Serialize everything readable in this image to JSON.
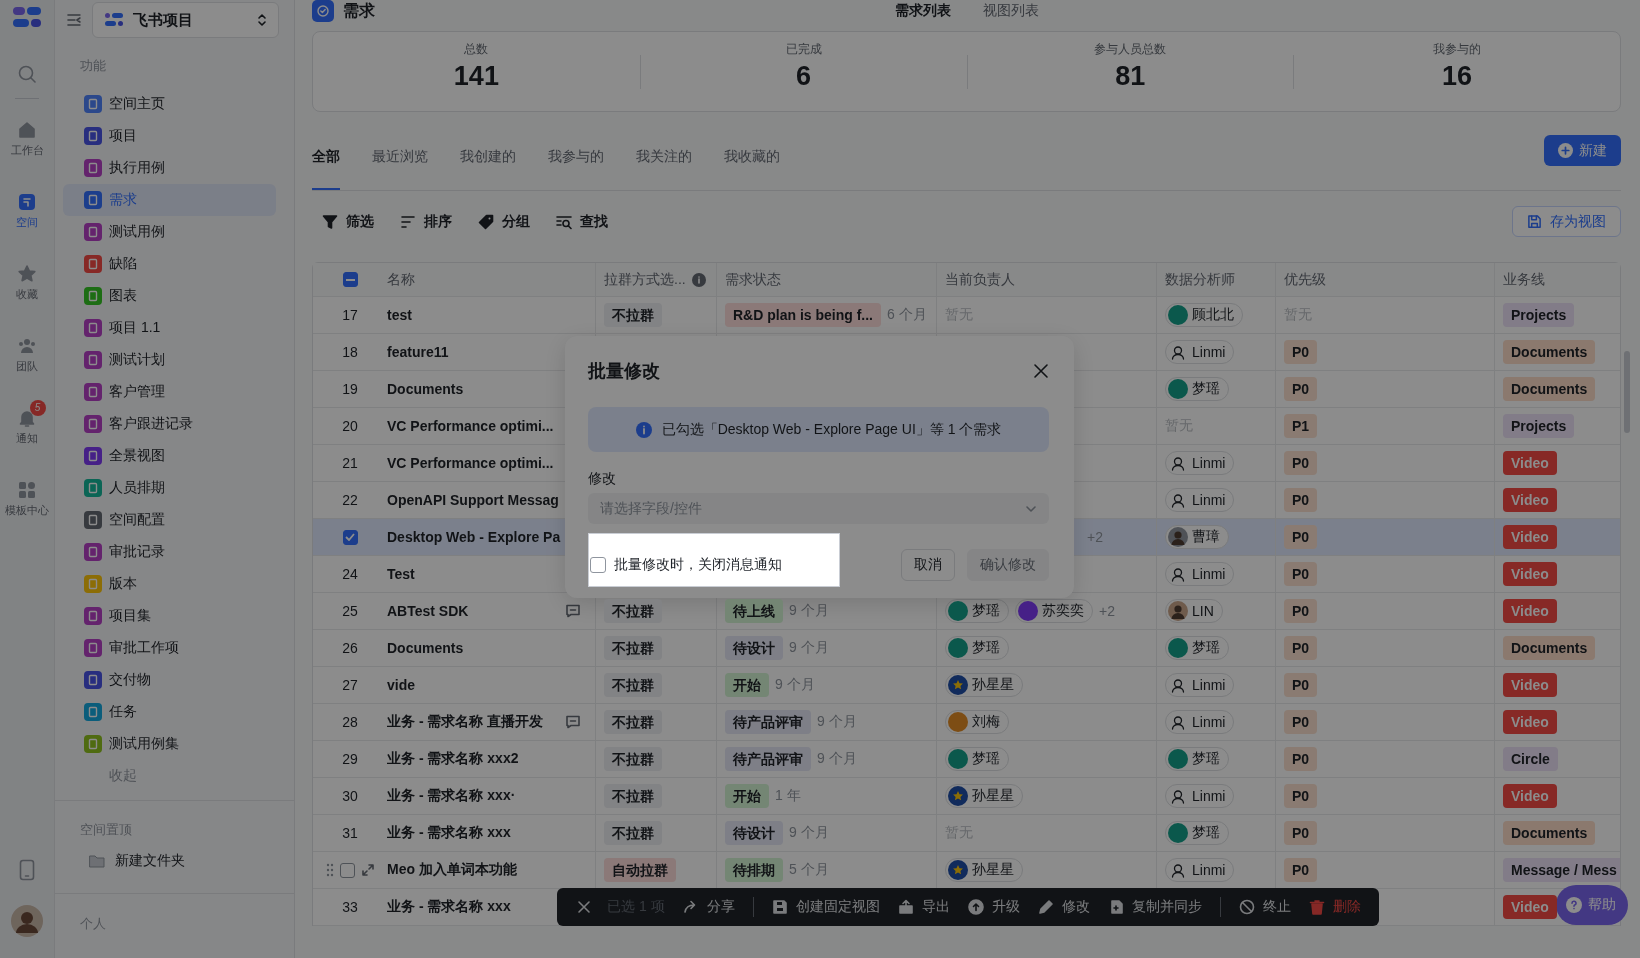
{
  "rail": {
    "items": [
      {
        "label": "工作台",
        "selected": false
      },
      {
        "label": "空间",
        "selected": true
      },
      {
        "label": "收藏",
        "selected": false
      },
      {
        "label": "团队",
        "selected": false
      },
      {
        "label": "通知",
        "selected": false,
        "badge": "5"
      },
      {
        "label": "模板中心",
        "selected": false
      }
    ]
  },
  "sidebar": {
    "project": "飞书项目",
    "section": "功能",
    "items": [
      {
        "label": "空间主页",
        "color": "#2b488b",
        "selected": false
      },
      {
        "label": "项目",
        "color": "#282e7f",
        "selected": false
      },
      {
        "label": "执行用例",
        "color": "#64236d",
        "selected": false
      },
      {
        "label": "需求",
        "color": "#1c3e8c",
        "selected": true
      },
      {
        "label": "测试用例",
        "color": "#64236d",
        "selected": false
      },
      {
        "label": "缺陷",
        "color": "#872926",
        "selected": false
      },
      {
        "label": "图表",
        "color": "#1d6d14",
        "selected": false
      },
      {
        "label": "项目 1.1",
        "color": "#64236d",
        "selected": false
      },
      {
        "label": "测试计划",
        "color": "#64236d",
        "selected": false
      },
      {
        "label": "客户管理",
        "color": "#64236d",
        "selected": false
      },
      {
        "label": "客户跟进记录",
        "color": "#64236d",
        "selected": false
      },
      {
        "label": "全景视图",
        "color": "#462087",
        "selected": false
      },
      {
        "label": "人员排期",
        "color": "#0b6555",
        "selected": false
      },
      {
        "label": "空间配置",
        "color": "#373a3f",
        "selected": false
      },
      {
        "label": "审批记录",
        "color": "#64236d",
        "selected": false
      },
      {
        "label": "版本",
        "color": "#8c6d06",
        "selected": false
      },
      {
        "label": "项目集",
        "color": "#64236d",
        "selected": false
      },
      {
        "label": "审批工作项",
        "color": "#64236d",
        "selected": false
      },
      {
        "label": "交付物",
        "color": "#282e7f",
        "selected": false
      },
      {
        "label": "任务",
        "color": "#0b5d7b",
        "selected": false
      },
      {
        "label": "测试用例集",
        "color": "#4f6b11",
        "selected": false
      }
    ],
    "collapse": "收起",
    "pinned_title": "空间置顶",
    "pinned_items": [
      "新建文件夹"
    ],
    "personal_title": "个人"
  },
  "main": {
    "title": "需求",
    "views": [
      {
        "label": "需求列表",
        "selected": true
      },
      {
        "label": "视图列表",
        "selected": false
      }
    ],
    "stats": [
      {
        "label": "总数",
        "value": "141"
      },
      {
        "label": "已完成",
        "value": "6"
      },
      {
        "label": "参与人员总数",
        "value": "81"
      },
      {
        "label": "我参与的",
        "value": "16"
      }
    ],
    "tabs": [
      {
        "label": "全部",
        "selected": true
      },
      {
        "label": "最近浏览",
        "selected": false
      },
      {
        "label": "我创建的",
        "selected": false
      },
      {
        "label": "我参与的",
        "selected": false
      },
      {
        "label": "我关注的",
        "selected": false
      },
      {
        "label": "我收藏的",
        "selected": false
      }
    ],
    "new_button": "新建",
    "toolbar": [
      "筛选",
      "排序",
      "分组",
      "查找"
    ],
    "save_view": "存为视图"
  },
  "table": {
    "header_checkbox": {
      "kind": "partial"
    },
    "columns": [
      {
        "label": "名称",
        "info": false
      },
      {
        "label": "拉群方式选...",
        "info": true
      },
      {
        "label": "需求状态",
        "info": false
      },
      {
        "label": "当前负责人",
        "info": false
      },
      {
        "label": "数据分析师",
        "info": false
      },
      {
        "label": "优先级",
        "info": false
      },
      {
        "label": "业务线",
        "info": false
      }
    ],
    "rows": [
      {
        "kind": "number",
        "number": "17",
        "selected": false,
        "name": "test",
        "comment": false,
        "group": {
          "text": "不拉群",
          "color": "#828385"
        },
        "status": {
          "text": "R&D plan is being f...",
          "color": "#8b7978"
        },
        "age": "6 个月",
        "owners": [
          {
            "kind": "empty",
            "text": "暂无"
          }
        ],
        "analyst": [
          {
            "kind": "initials",
            "name": "顾北北",
            "color": "#0b584c"
          }
        ],
        "priority": {
          "kind": "empty",
          "text": "暂无"
        },
        "biz": {
          "text": "Projects",
          "color": "#827c88"
        }
      },
      {
        "kind": "number",
        "number": "18",
        "selected": false,
        "name": "feature11",
        "comment": false,
        "analyst": [
          {
            "kind": "outline",
            "name": "Linmi",
            "color": "#8c8c8c"
          }
        ],
        "priority": {
          "kind": "tag",
          "text": "P0"
        },
        "biz": {
          "text": "Documents",
          "color": "#8b796e"
        }
      },
      {
        "kind": "number",
        "number": "19",
        "selected": false,
        "name": "Documents",
        "comment": false,
        "analyst": [
          {
            "kind": "initials",
            "name": "梦瑶",
            "color": "#0b584c"
          }
        ],
        "priority": {
          "kind": "tag",
          "text": "P0"
        },
        "biz": {
          "text": "Documents",
          "color": "#8b796e"
        }
      },
      {
        "kind": "number",
        "number": "20",
        "selected": false,
        "name": "VC Performance optimi...",
        "comment": false,
        "analyst": [
          {
            "kind": "empty",
            "text": "暂无"
          }
        ],
        "priority": {
          "kind": "tag",
          "text": "P1"
        },
        "biz": {
          "text": "Projects",
          "color": "#827c88"
        }
      },
      {
        "kind": "number",
        "number": "21",
        "selected": false,
        "name": "VC Performance optimi...",
        "comment": false,
        "analyst": [
          {
            "kind": "outline",
            "name": "Linmi",
            "color": "#8c8c8c"
          }
        ],
        "priority": {
          "kind": "tag",
          "text": "P0"
        },
        "biz": {
          "text": "Video",
          "color": "#872926"
        }
      },
      {
        "kind": "number",
        "number": "22",
        "selected": false,
        "name": "OpenAPI Support Messag",
        "comment": false,
        "analyst": [
          {
            "kind": "outline",
            "name": "Linmi",
            "color": "#8c8c8c"
          }
        ],
        "priority": {
          "kind": "tag",
          "text": "P0"
        },
        "biz": {
          "text": "Video",
          "color": "#872926"
        }
      },
      {
        "kind": "number",
        "selected": true,
        "name": "Desktop Web - Explore Pa",
        "comment": false,
        "owners": [
          {
            "kind": "more",
            "text": "+2"
          }
        ],
        "analyst": [
          {
            "kind": "photo",
            "name": "曹璋",
            "color": "#4f5257"
          }
        ],
        "priority": {
          "kind": "tag",
          "text": "P0"
        },
        "biz": {
          "text": "Video",
          "color": "#872926"
        }
      },
      {
        "kind": "number",
        "number": "24",
        "selected": false,
        "name": "Test",
        "comment": false,
        "analyst": [
          {
            "kind": "outline",
            "name": "Linmi",
            "color": "#8c8c8c"
          }
        ],
        "priority": {
          "kind": "tag",
          "text": "P0"
        },
        "biz": {
          "text": "Video",
          "color": "#872926"
        }
      },
      {
        "kind": "number",
        "number": "25",
        "selected": false,
        "name": "ABTest SDK",
        "comment": true,
        "group": {
          "text": "不拉群",
          "color": "#828385"
        },
        "status": {
          "text": "待上线",
          "color": "#748674"
        },
        "age": "9 个月",
        "owners": [
          {
            "kind": "initials",
            "name": "梦瑶",
            "color": "#0b584c"
          },
          {
            "kind": "initials",
            "name": "苏奕奕",
            "color": "#462087"
          },
          {
            "kind": "more",
            "text": "+2"
          }
        ],
        "analyst": [
          {
            "kind": "photo",
            "name": "LIN",
            "color": "#6f5b4c"
          }
        ],
        "priority": {
          "kind": "tag",
          "text": "P0"
        },
        "biz": {
          "text": "Video",
          "color": "#872926"
        }
      },
      {
        "kind": "number",
        "number": "26",
        "selected": false,
        "name": "Documents",
        "comment": false,
        "group": {
          "text": "不拉群",
          "color": "#828385"
        },
        "status": {
          "text": "待设计",
          "color": "#7e7f87"
        },
        "age": "9 个月",
        "owners": [
          {
            "kind": "initials",
            "name": "梦瑶",
            "color": "#0b584c"
          }
        ],
        "analyst": [
          {
            "kind": "initials",
            "name": "梦瑶",
            "color": "#0b584c"
          }
        ],
        "priority": {
          "kind": "tag",
          "text": "P0"
        },
        "biz": {
          "text": "Documents",
          "color": "#8b796e"
        }
      },
      {
        "kind": "number",
        "number": "27",
        "selected": false,
        "name": "vide",
        "comment": false,
        "group": {
          "text": "不拉群",
          "color": "#828385"
        },
        "status": {
          "text": "开始",
          "color": "#748674"
        },
        "age": "9 个月",
        "owners": [
          {
            "kind": "star",
            "name": "孙星星",
            "color": "#112b5c"
          }
        ],
        "analyst": [
          {
            "kind": "outline",
            "name": "Linmi",
            "color": "#8c8c8c"
          }
        ],
        "priority": {
          "kind": "tag",
          "text": "P0"
        },
        "biz": {
          "text": "Video",
          "color": "#872926"
        }
      },
      {
        "kind": "number",
        "number": "28",
        "selected": false,
        "name": "业务 - 需求名称 直播开发",
        "comment": true,
        "group": {
          "text": "不拉群",
          "color": "#828385"
        },
        "status": {
          "text": "待产品评审",
          "color": "#7e7f87"
        },
        "age": "9 个月",
        "owners": [
          {
            "kind": "initials",
            "name": "刘梅",
            "color": "#7d4d14"
          }
        ],
        "analyst": [
          {
            "kind": "outline",
            "name": "Linmi",
            "color": "#8c8c8c"
          }
        ],
        "priority": {
          "kind": "tag",
          "text": "P0"
        },
        "biz": {
          "text": "Video",
          "color": "#872926"
        }
      },
      {
        "kind": "number",
        "number": "29",
        "selected": false,
        "name": "业务 - 需求名称 xxx2",
        "comment": false,
        "group": {
          "text": "不拉群",
          "color": "#828385"
        },
        "status": {
          "text": "待产品评审",
          "color": "#7e7f87"
        },
        "age": "9 个月",
        "owners": [
          {
            "kind": "initials",
            "name": "梦瑶",
            "color": "#0b584c"
          }
        ],
        "analyst": [
          {
            "kind": "initials",
            "name": "梦瑶",
            "color": "#0b584c"
          }
        ],
        "priority": {
          "kind": "tag",
          "text": "P0"
        },
        "biz": {
          "text": "Circle",
          "color": "#827c88"
        }
      },
      {
        "kind": "number",
        "number": "30",
        "selected": false,
        "name": "业务 - 需求名称 xxx·",
        "comment": false,
        "group": {
          "text": "不拉群",
          "color": "#828385"
        },
        "status": {
          "text": "开始",
          "color": "#748674"
        },
        "age": "1 年",
        "owners": [
          {
            "kind": "star",
            "name": "孙星星",
            "color": "#112b5c"
          }
        ],
        "analyst": [
          {
            "kind": "outline",
            "name": "Linmi",
            "color": "#8c8c8c"
          }
        ],
        "priority": {
          "kind": "tag",
          "text": "P0"
        },
        "biz": {
          "text": "Video",
          "color": "#872926"
        }
      },
      {
        "kind": "number",
        "number": "31",
        "selected": false,
        "name": "业务 - 需求名称 xxx",
        "comment": false,
        "group": {
          "text": "不拉群",
          "color": "#828385"
        },
        "status": {
          "text": "待设计",
          "color": "#7e7f87"
        },
        "age": "9 个月",
        "owners": [
          {
            "kind": "empty",
            "text": "暂无"
          }
        ],
        "analyst": [
          {
            "kind": "initials",
            "name": "梦瑶",
            "color": "#0b584c"
          }
        ],
        "priority": {
          "kind": "tag",
          "text": "P0"
        },
        "biz": {
          "text": "Documents",
          "color": "#8b796e"
        }
      },
      {
        "kind": "handle",
        "selected": false,
        "name": "Meo 加入单词本功能",
        "comment": false,
        "group": {
          "text": "自动拉群",
          "color": "#8b7978"
        },
        "status": {
          "text": "待排期",
          "color": "#748674"
        },
        "age": "5 个月",
        "owners": [
          {
            "kind": "star",
            "name": "孙星星",
            "color": "#112b5c"
          }
        ],
        "analyst": [
          {
            "kind": "outline",
            "name": "Linmi",
            "color": "#8c8c8c"
          }
        ],
        "priority": {
          "kind": "tag",
          "text": "P0"
        },
        "biz": {
          "text": "Message / Mess",
          "color": "#827c88"
        }
      },
      {
        "kind": "number",
        "number": "33",
        "selected": false,
        "name": "业务 - 需求名称 xxx",
        "comment": false,
        "biz": {
          "text": "Video",
          "color": "#872926"
        }
      }
    ]
  },
  "modal": {
    "title": "批量修改",
    "notice": "已勾选「Desktop Web - Explore Page UI」等 1 个需求",
    "field_label": "修改",
    "select_placeholder": "请选择字段/控件",
    "mute": {
      "label": "批量修改时，关闭消息通知",
      "checked": false,
      "highlighted": true
    },
    "cancel": "取消",
    "confirm": {
      "label": "确认修改",
      "disabled": true
    }
  },
  "action_bar": {
    "count": "已选 1 项",
    "items": [
      {
        "label": "分享",
        "kind": "normal"
      },
      {
        "kind": "divider"
      },
      {
        "label": "创建固定视图",
        "kind": "normal"
      },
      {
        "label": "导出",
        "kind": "normal"
      },
      {
        "label": "升级",
        "kind": "normal"
      },
      {
        "label": "修改",
        "kind": "normal"
      },
      {
        "label": "复制并同步",
        "kind": "normal"
      },
      {
        "kind": "divider"
      },
      {
        "label": "终止",
        "kind": "normal"
      },
      {
        "label": "删除",
        "kind": "danger"
      }
    ]
  },
  "help": {
    "label": "帮助"
  }
}
